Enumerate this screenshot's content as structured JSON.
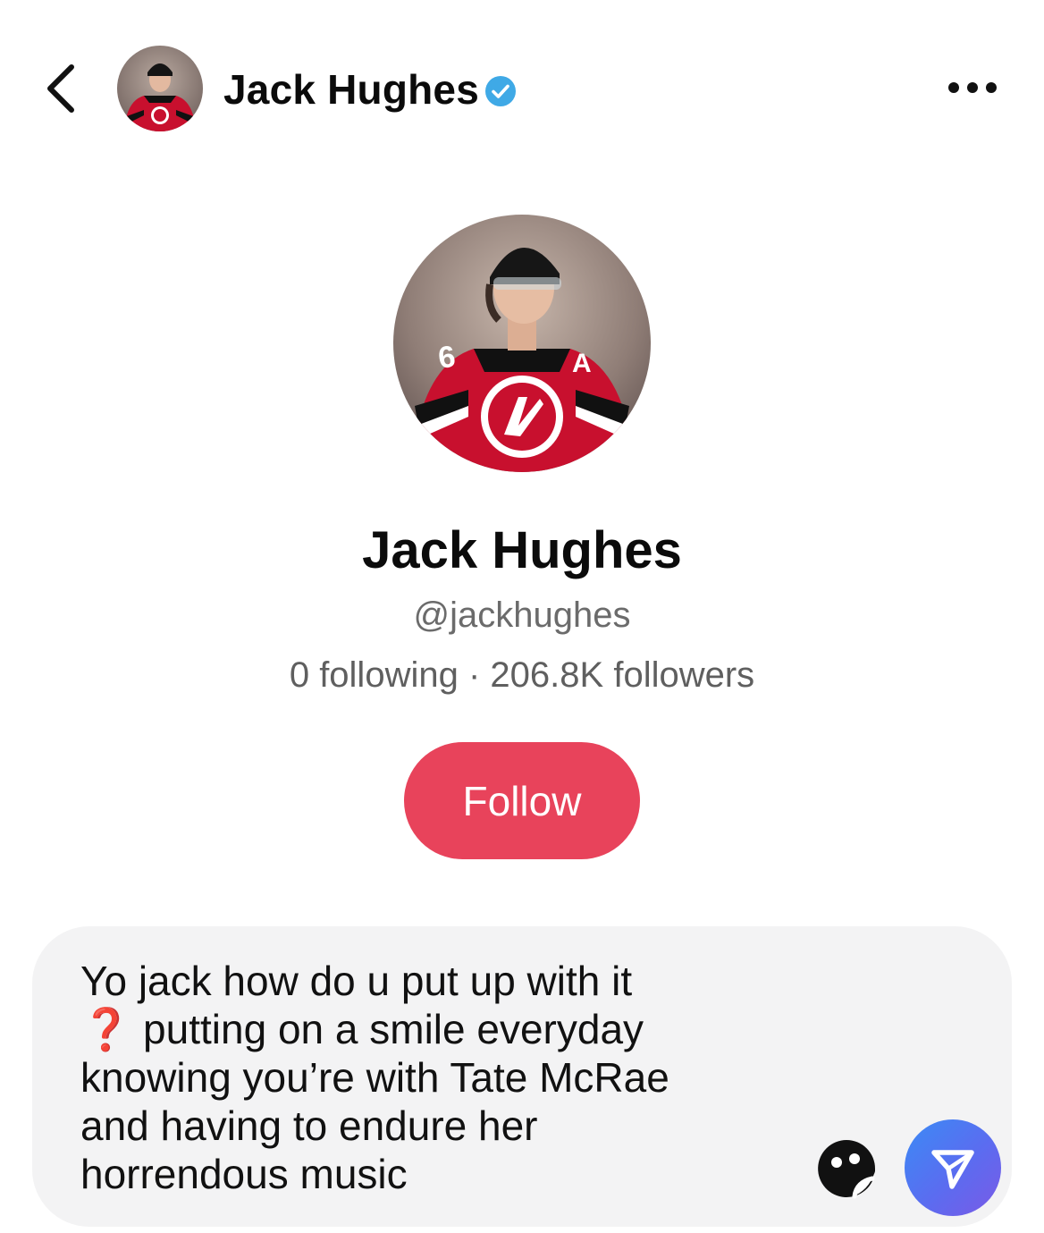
{
  "header": {
    "display_name": "Jack Hughes",
    "verified": true,
    "back_icon": "chevron-left-icon",
    "more_icon": "more-horizontal-icon"
  },
  "profile": {
    "name": "Jack Hughes",
    "handle": "@jackhughes",
    "following_count": "0",
    "following_label": "following",
    "separator": "·",
    "followers_count": "206.8K",
    "followers_label": "followers",
    "follow_button_label": "Follow"
  },
  "composer": {
    "message_line1": "Yo jack how do u put up with it",
    "message_question_mark": "❓",
    "message_rest": " putting on a smile everyday\nknowing you’re with Tate McRae\nand having to endure her\nhorrendous music",
    "sticker_icon": "sticker-face-icon",
    "send_icon": "send-icon"
  },
  "colors": {
    "follow_button": "#e8435b",
    "verified_badge": "#3fa9e6",
    "send_gradient_start": "#3b8bf5",
    "send_gradient_end": "#7a5ae6",
    "composer_bg": "#f3f3f4",
    "secondary_text": "#6b6b6b"
  }
}
